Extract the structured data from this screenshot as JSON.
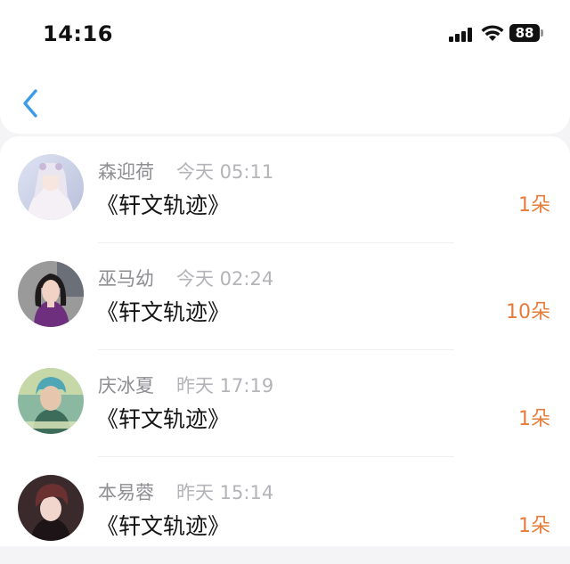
{
  "status_bar": {
    "time": "14:16",
    "battery": "88"
  },
  "nav": {
    "back_icon": "chevron-left-icon",
    "accent_color": "#3b9ce8"
  },
  "gifts": [
    {
      "name": "森迎荷",
      "time": "今天 05:11",
      "title": "《轩文轨迹》",
      "amount": "1朵"
    },
    {
      "name": "巫马幼",
      "time": "今天 02:24",
      "title": "《轩文轨迹》",
      "amount": "10朵"
    },
    {
      "name": "庆冰夏",
      "time": "昨天 17:19",
      "title": "《轩文轨迹》",
      "amount": "1朵"
    },
    {
      "name": "本易蓉",
      "time": "昨天 15:14",
      "title": "《轩文轨迹》",
      "amount": "1朵"
    }
  ],
  "colors": {
    "amount": "#e57c3a",
    "name": "#8e8e93",
    "time": "#b4b4b8"
  }
}
